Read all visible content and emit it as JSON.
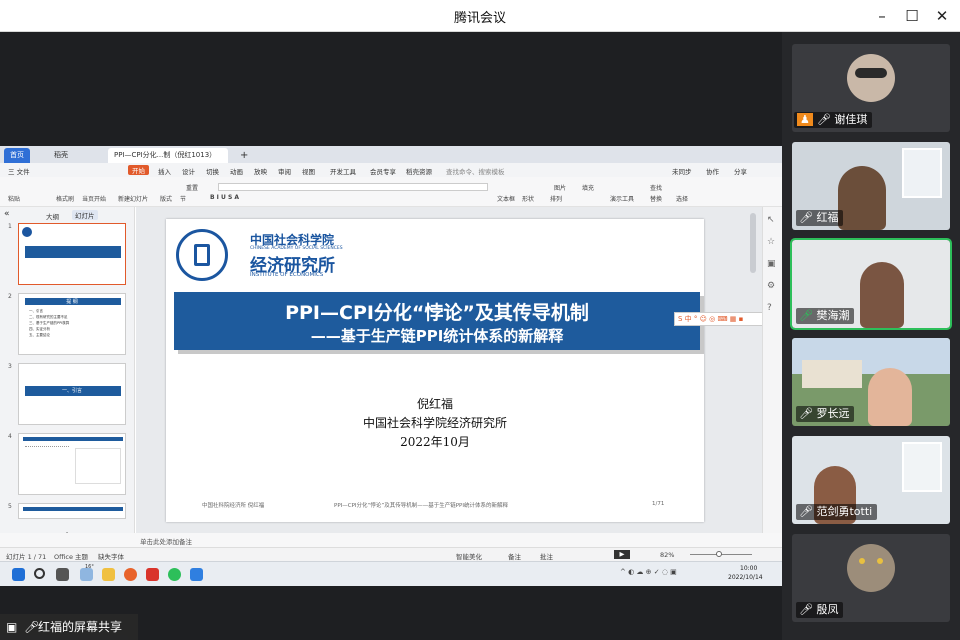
{
  "window": {
    "title": "腾讯会议"
  },
  "share": {
    "label": "红福的屏幕共享"
  },
  "wps": {
    "tabs": [
      "首页",
      "稻壳",
      "PPI—CPI分化...制（倪红1013）"
    ],
    "menu": [
      "三 文件",
      "开始",
      "插入",
      "设计",
      "切换",
      "动画",
      "放映",
      "审阅",
      "视图",
      "开发工具",
      "会员专享",
      "稻壳资源",
      "查找命令、搜索模板",
      "未同步",
      "协作",
      "分享"
    ],
    "ribbon": [
      "粘贴",
      "格式刷",
      "当页开始",
      "新建幻灯片",
      "版式",
      "节",
      "重置",
      "文本框",
      "形状",
      "排列",
      "图片",
      "填充",
      "查找",
      "替换",
      "选择",
      "演示工具"
    ],
    "panel_tabs": [
      "大纲",
      "幻灯片"
    ],
    "slide_numbers": [
      "1",
      "2",
      "3",
      "4",
      "5"
    ],
    "status": {
      "slide": "幻灯片 1 / 71",
      "theme": "Office 主题",
      "font": "缺失字体",
      "notes": "单击此处添加备注",
      "beautify": "智能美化",
      "comment": "备注",
      "annot": "批注",
      "zoom": "82%"
    }
  },
  "slide": {
    "org_cn": "中国社会科学院",
    "org_en": "CHINESE ACADEMY OF SOCIAL SCIENCES",
    "inst_cn": "经济研究所",
    "inst_en": "INSTITUTE OF ECONOMICS",
    "title": "PPI—CPI分化“悖论”及其传导机制",
    "subtitle": "——基于生产链PPI统计体系的新解释",
    "author": "倪红福",
    "affiliation": "中国社会科学院经济研究所",
    "date": "2022年10月",
    "footer_left": "中国社科院经济所 倪红福",
    "footer_mid": "PPI—CPI分化“悖论”及其传导机制——基于生产链PPI统计体系的新解释",
    "footer_right": "1/71"
  },
  "thumb2": {
    "heading": "提 纲",
    "items": [
      "一、引言",
      "二、现有研究的主要不足",
      "三、基于生产链的PPI核算",
      "四、实证分析",
      "五、主要结论"
    ]
  },
  "thumb3": {
    "heading": "一、引言"
  },
  "taskbar": {
    "time": "10:00",
    "date": "2022/10/14",
    "temp": "16°"
  },
  "participants": [
    {
      "name": "谢佳琪",
      "bg": "#2b2c30"
    },
    {
      "name": "红福",
      "bg": "#cfd6dc"
    },
    {
      "name": "樊海潮",
      "bg": "#e6e8ea"
    },
    {
      "name": "罗长远",
      "bg": "#7a9a6a"
    },
    {
      "name": "范剑勇totti",
      "bg": "#dde3e8"
    },
    {
      "name": "殷凤",
      "bg": "#2b2c30"
    }
  ],
  "colors": {
    "banner": "#1e5b9d",
    "wps_accent": "#e15a2b",
    "active_speaker": "#2dbf5a",
    "logo_blue": "#1b56a0"
  }
}
